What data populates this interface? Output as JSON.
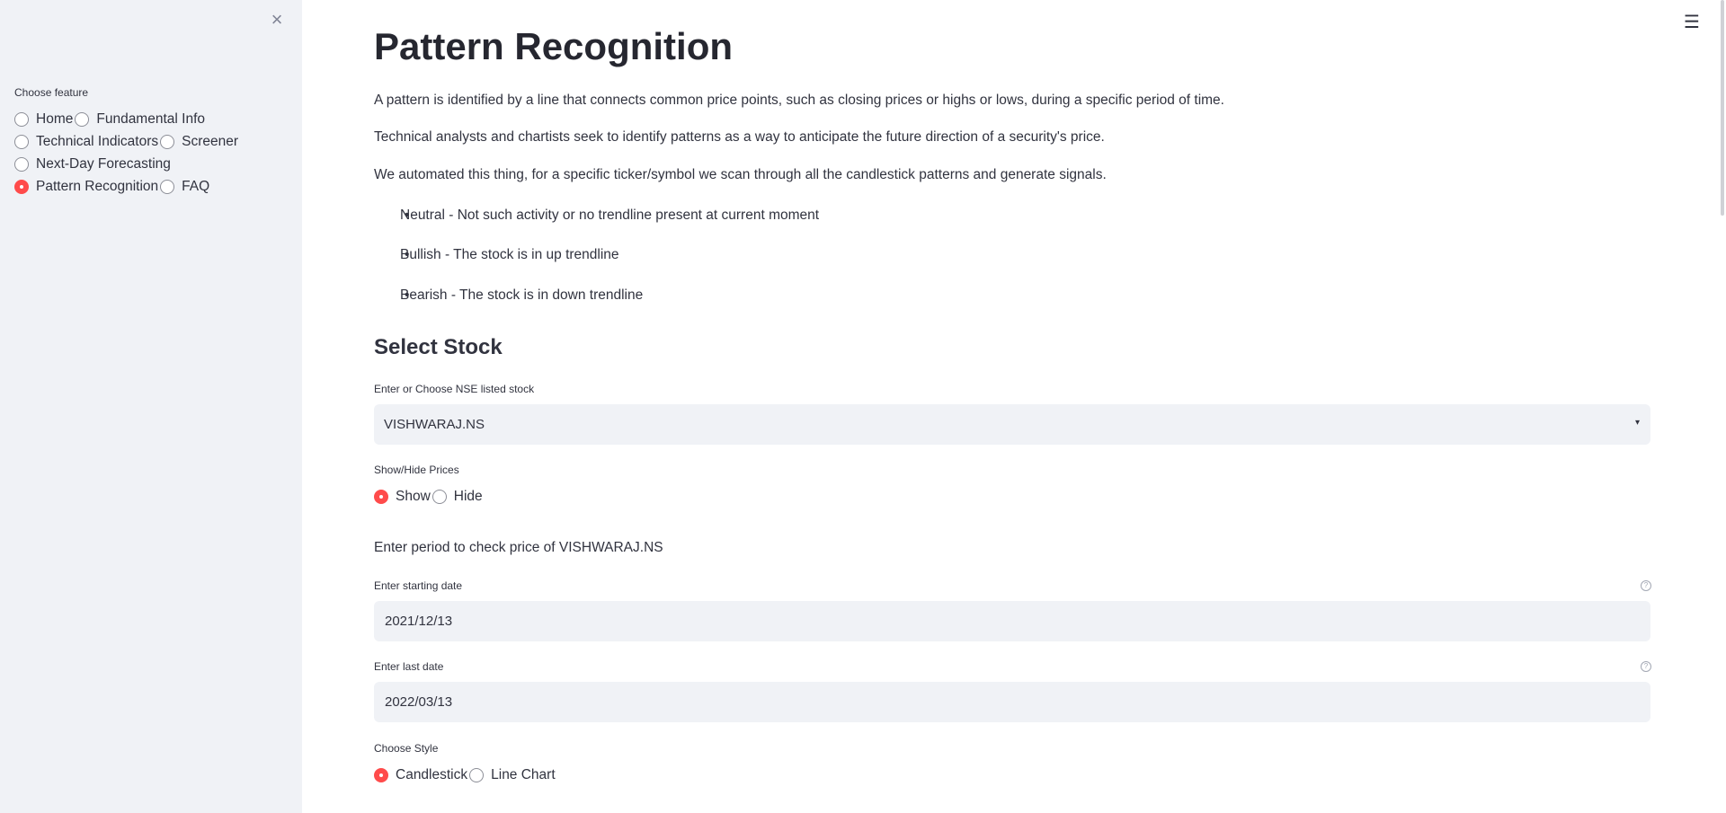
{
  "sidebar": {
    "label": "Choose feature",
    "options": [
      "Home",
      "Fundamental Info",
      "Technical Indicators",
      "Screener",
      "Next-Day Forecasting",
      "Pattern Recognition",
      "FAQ"
    ],
    "selected": "Pattern Recognition"
  },
  "main": {
    "title": "Pattern Recognition",
    "paragraphs": [
      "A pattern is identified by a line that connects common price points, such as closing prices or highs or lows, during a specific period of time.",
      "Technical analysts and chartists seek to identify patterns as a way to anticipate the future direction of a security's price.",
      "We automated this thing, for a specific ticker/symbol we scan through all the candlestick patterns and generate signals."
    ],
    "bullets": [
      "Neutral - Not such activity or no trendline present at current moment",
      "Bullish - The stock is in up trendline",
      "Bearish - The stock is in down trendline"
    ],
    "select_stock": {
      "heading": "Select Stock",
      "label": "Enter or Choose NSE listed stock",
      "value": "VISHWARAJ.NS"
    },
    "show_hide": {
      "label": "Show/Hide Prices",
      "options": [
        "Show",
        "Hide"
      ],
      "selected": "Show"
    },
    "period_text": "Enter period to check price of VISHWARAJ.NS",
    "start_date": {
      "label": "Enter starting date",
      "value": "2021/12/13"
    },
    "end_date": {
      "label": "Enter last date",
      "value": "2022/03/13"
    },
    "style": {
      "label": "Choose Style",
      "options": [
        "Candlestick",
        "Line Chart"
      ],
      "selected": "Candlestick"
    }
  },
  "colors": {
    "accent": "#ff4b4b",
    "sidebar_bg": "#f0f2f6",
    "input_bg": "#f0f2f6",
    "text": "#31333f"
  },
  "icons": {
    "close": "close-icon",
    "menu": "hamburger-menu-icon",
    "help": "help-circle-icon",
    "caret": "chevron-down-icon"
  }
}
